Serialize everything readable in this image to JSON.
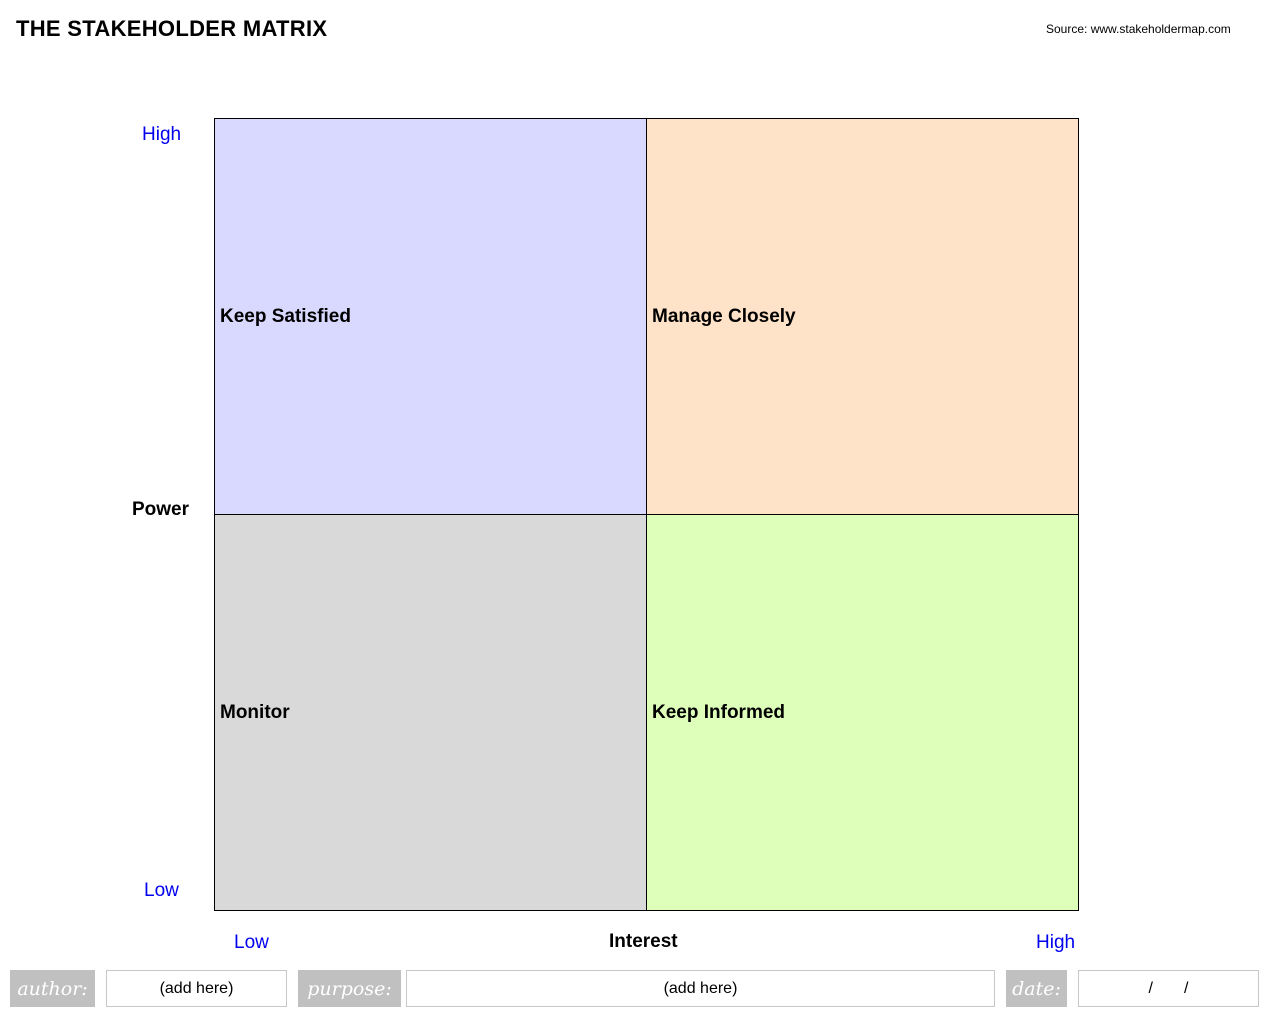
{
  "header": {
    "title": "THE STAKEHOLDER MATRIX",
    "source": "Source: www.stakeholdermap.com"
  },
  "matrix": {
    "quadrants": {
      "top_left": {
        "label": "Keep Satisfied",
        "color": "#d9d9ff"
      },
      "top_right": {
        "label": "Manage Closely",
        "color": "#ffe3c8"
      },
      "bottom_left": {
        "label": "Monitor",
        "color": "#d9d9d9"
      },
      "bottom_right": {
        "label": "Keep Informed",
        "color": "#ddffb9"
      }
    }
  },
  "axes": {
    "y": {
      "title": "Power",
      "high": "High",
      "low": "Low"
    },
    "x": {
      "title": "Interest",
      "low": "Low",
      "high": "High"
    },
    "tick_color": "#0000ee"
  },
  "footer": {
    "author_label": "author:",
    "author_value": "(add here)",
    "purpose_label": "purpose:",
    "purpose_value": "(add here)",
    "date_label": "date:",
    "date_value": "/       /"
  }
}
